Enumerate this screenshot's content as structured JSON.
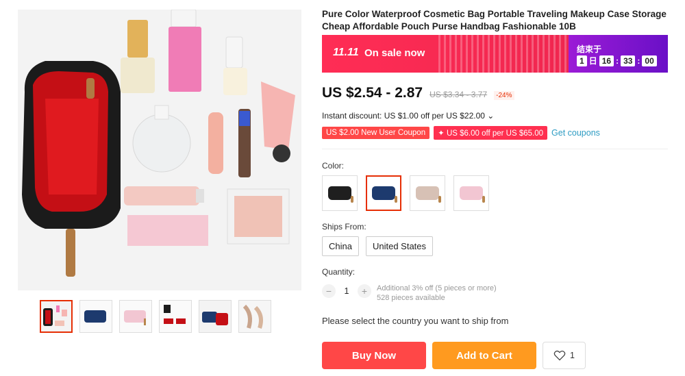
{
  "product": {
    "title": "Pure Color Waterproof Cosmetic Bag Portable Traveling Makeup Case Storage Cheap Affordable Pouch Purse Handbag Fashionable 10B"
  },
  "banner": {
    "sale_number": "11.11",
    "sale_text": "On sale now",
    "ends_label": "结束于",
    "countdown": {
      "days": "1",
      "days_unit": "日",
      "hours": "16",
      "minutes": "33",
      "seconds": "00",
      "separator": ":"
    }
  },
  "pricing": {
    "price": "US $2.54 - 2.87",
    "old_price": "US $3.34 - 3.77",
    "discount": "-24%",
    "instant_discount": "Instant discount: US $1.00 off per US $22.00 ⌄"
  },
  "coupons": {
    "new_user": "US $2.00 New User Coupon",
    "store": "✦ US $6.00 off per US $65.00",
    "get_link": "Get coupons"
  },
  "color": {
    "label": "Color:",
    "options": [
      "#1f1f1f",
      "#1d3a6e",
      "#d7c1b5",
      "#f2c6d2"
    ],
    "selected_index": 1
  },
  "ships_from": {
    "label": "Ships From:",
    "options": [
      "China",
      "United States"
    ]
  },
  "quantity": {
    "label": "Quantity:",
    "value": "1",
    "minus": "−",
    "plus": "+",
    "additional": "Additional 3% off (5 pieces or more)",
    "available": "528 pieces available"
  },
  "shipping_notice": "Please select the country you want to ship from",
  "actions": {
    "buy_now": "Buy Now",
    "add_to_cart": "Add to Cart",
    "wishlist_count": "1"
  },
  "colors": {
    "accent_red": "#ff4747",
    "accent_orange": "#ff9a1f",
    "link_blue": "#2e9cc3"
  }
}
